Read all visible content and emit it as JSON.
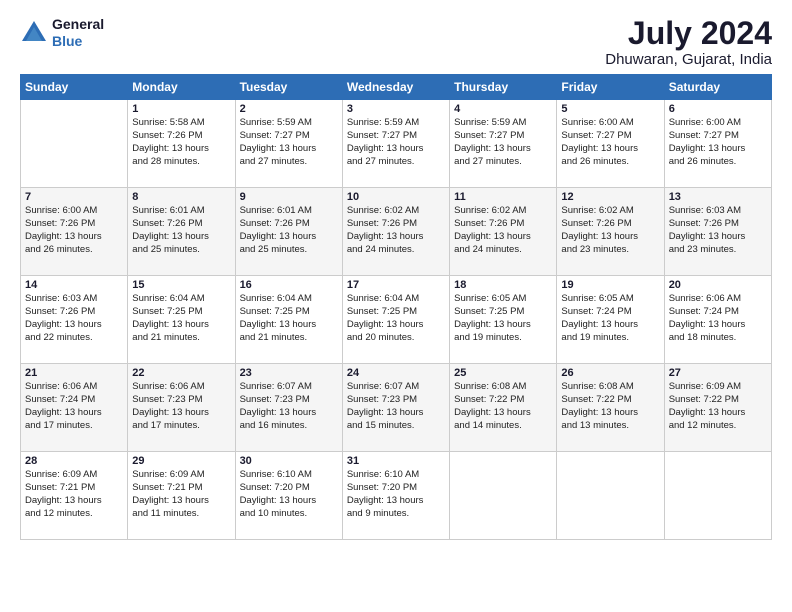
{
  "header": {
    "logo_line1": "General",
    "logo_line2": "Blue",
    "title": "July 2024",
    "subtitle": "Dhuwaran, Gujarat, India"
  },
  "weekdays": [
    "Sunday",
    "Monday",
    "Tuesday",
    "Wednesday",
    "Thursday",
    "Friday",
    "Saturday"
  ],
  "weeks": [
    [
      {
        "day": "",
        "info": ""
      },
      {
        "day": "1",
        "info": "Sunrise: 5:58 AM\nSunset: 7:26 PM\nDaylight: 13 hours\nand 28 minutes."
      },
      {
        "day": "2",
        "info": "Sunrise: 5:59 AM\nSunset: 7:27 PM\nDaylight: 13 hours\nand 27 minutes."
      },
      {
        "day": "3",
        "info": "Sunrise: 5:59 AM\nSunset: 7:27 PM\nDaylight: 13 hours\nand 27 minutes."
      },
      {
        "day": "4",
        "info": "Sunrise: 5:59 AM\nSunset: 7:27 PM\nDaylight: 13 hours\nand 27 minutes."
      },
      {
        "day": "5",
        "info": "Sunrise: 6:00 AM\nSunset: 7:27 PM\nDaylight: 13 hours\nand 26 minutes."
      },
      {
        "day": "6",
        "info": "Sunrise: 6:00 AM\nSunset: 7:27 PM\nDaylight: 13 hours\nand 26 minutes."
      }
    ],
    [
      {
        "day": "7",
        "info": "Sunrise: 6:00 AM\nSunset: 7:26 PM\nDaylight: 13 hours\nand 26 minutes."
      },
      {
        "day": "8",
        "info": "Sunrise: 6:01 AM\nSunset: 7:26 PM\nDaylight: 13 hours\nand 25 minutes."
      },
      {
        "day": "9",
        "info": "Sunrise: 6:01 AM\nSunset: 7:26 PM\nDaylight: 13 hours\nand 25 minutes."
      },
      {
        "day": "10",
        "info": "Sunrise: 6:02 AM\nSunset: 7:26 PM\nDaylight: 13 hours\nand 24 minutes."
      },
      {
        "day": "11",
        "info": "Sunrise: 6:02 AM\nSunset: 7:26 PM\nDaylight: 13 hours\nand 24 minutes."
      },
      {
        "day": "12",
        "info": "Sunrise: 6:02 AM\nSunset: 7:26 PM\nDaylight: 13 hours\nand 23 minutes."
      },
      {
        "day": "13",
        "info": "Sunrise: 6:03 AM\nSunset: 7:26 PM\nDaylight: 13 hours\nand 23 minutes."
      }
    ],
    [
      {
        "day": "14",
        "info": "Sunrise: 6:03 AM\nSunset: 7:26 PM\nDaylight: 13 hours\nand 22 minutes."
      },
      {
        "day": "15",
        "info": "Sunrise: 6:04 AM\nSunset: 7:25 PM\nDaylight: 13 hours\nand 21 minutes."
      },
      {
        "day": "16",
        "info": "Sunrise: 6:04 AM\nSunset: 7:25 PM\nDaylight: 13 hours\nand 21 minutes."
      },
      {
        "day": "17",
        "info": "Sunrise: 6:04 AM\nSunset: 7:25 PM\nDaylight: 13 hours\nand 20 minutes."
      },
      {
        "day": "18",
        "info": "Sunrise: 6:05 AM\nSunset: 7:25 PM\nDaylight: 13 hours\nand 19 minutes."
      },
      {
        "day": "19",
        "info": "Sunrise: 6:05 AM\nSunset: 7:24 PM\nDaylight: 13 hours\nand 19 minutes."
      },
      {
        "day": "20",
        "info": "Sunrise: 6:06 AM\nSunset: 7:24 PM\nDaylight: 13 hours\nand 18 minutes."
      }
    ],
    [
      {
        "day": "21",
        "info": "Sunrise: 6:06 AM\nSunset: 7:24 PM\nDaylight: 13 hours\nand 17 minutes."
      },
      {
        "day": "22",
        "info": "Sunrise: 6:06 AM\nSunset: 7:23 PM\nDaylight: 13 hours\nand 17 minutes."
      },
      {
        "day": "23",
        "info": "Sunrise: 6:07 AM\nSunset: 7:23 PM\nDaylight: 13 hours\nand 16 minutes."
      },
      {
        "day": "24",
        "info": "Sunrise: 6:07 AM\nSunset: 7:23 PM\nDaylight: 13 hours\nand 15 minutes."
      },
      {
        "day": "25",
        "info": "Sunrise: 6:08 AM\nSunset: 7:22 PM\nDaylight: 13 hours\nand 14 minutes."
      },
      {
        "day": "26",
        "info": "Sunrise: 6:08 AM\nSunset: 7:22 PM\nDaylight: 13 hours\nand 13 minutes."
      },
      {
        "day": "27",
        "info": "Sunrise: 6:09 AM\nSunset: 7:22 PM\nDaylight: 13 hours\nand 12 minutes."
      }
    ],
    [
      {
        "day": "28",
        "info": "Sunrise: 6:09 AM\nSunset: 7:21 PM\nDaylight: 13 hours\nand 12 minutes."
      },
      {
        "day": "29",
        "info": "Sunrise: 6:09 AM\nSunset: 7:21 PM\nDaylight: 13 hours\nand 11 minutes."
      },
      {
        "day": "30",
        "info": "Sunrise: 6:10 AM\nSunset: 7:20 PM\nDaylight: 13 hours\nand 10 minutes."
      },
      {
        "day": "31",
        "info": "Sunrise: 6:10 AM\nSunset: 7:20 PM\nDaylight: 13 hours\nand 9 minutes."
      },
      {
        "day": "",
        "info": ""
      },
      {
        "day": "",
        "info": ""
      },
      {
        "day": "",
        "info": ""
      }
    ]
  ]
}
